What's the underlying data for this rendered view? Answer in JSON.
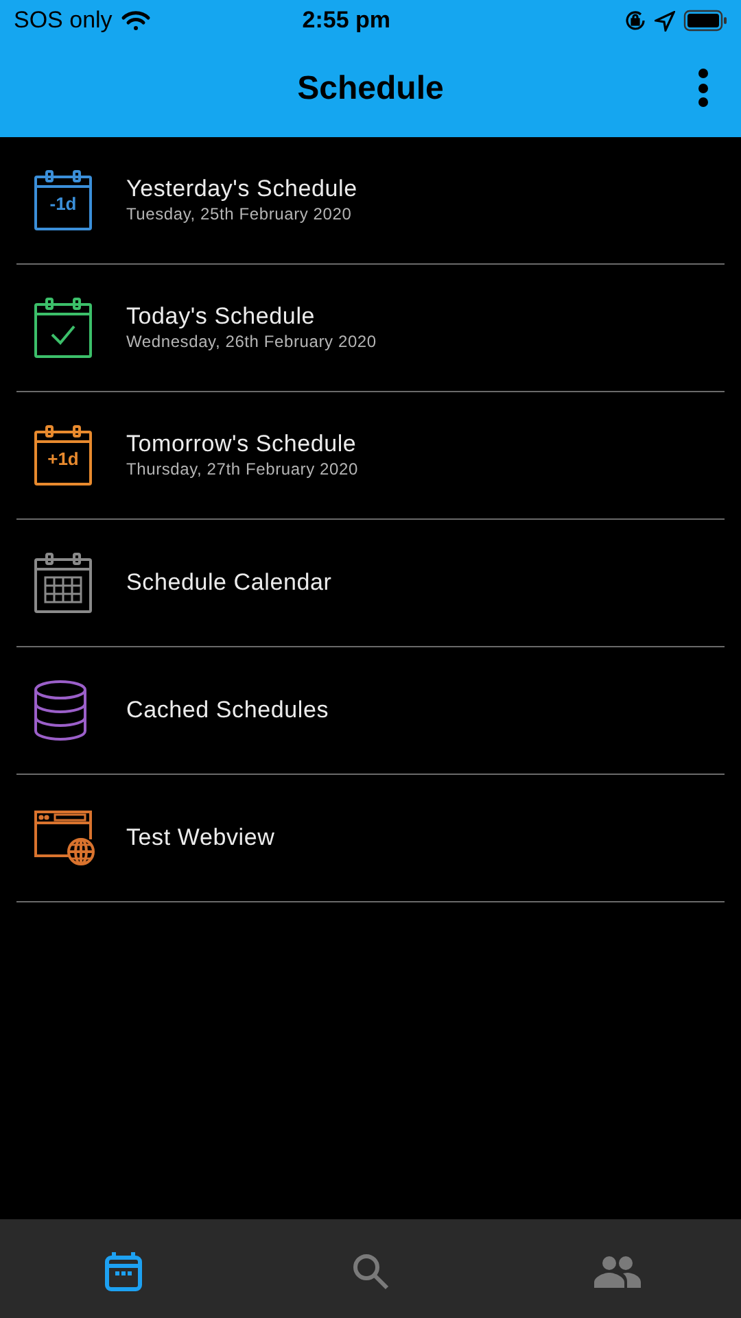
{
  "status_bar": {
    "carrier": "SOS only",
    "time": "2:55 pm"
  },
  "header": {
    "title": "Schedule"
  },
  "menu_items": [
    {
      "kind": "day",
      "icon_text": "-1d",
      "color": "#3b8fd9",
      "title": "Yesterday's Schedule",
      "subtitle": "Tuesday, 25th February 2020"
    },
    {
      "kind": "today",
      "color": "#3cbf6a",
      "title": "Today's Schedule",
      "subtitle": "Wednesday, 26th February 2020"
    },
    {
      "kind": "day",
      "icon_text": "+1d",
      "color": "#e88a2e",
      "title": "Tomorrow's Schedule",
      "subtitle": "Thursday, 27th February 2020"
    },
    {
      "kind": "calendar",
      "color": "#8a8a8a",
      "title": "Schedule Calendar"
    },
    {
      "kind": "database",
      "color": "#9b5fc9",
      "title": "Cached Schedules"
    },
    {
      "kind": "webview",
      "color": "#d9732e",
      "title": "Test Webview"
    }
  ],
  "tabs": [
    {
      "kind": "schedule",
      "selected": true
    },
    {
      "kind": "search",
      "selected": false
    },
    {
      "kind": "people",
      "selected": false
    }
  ]
}
